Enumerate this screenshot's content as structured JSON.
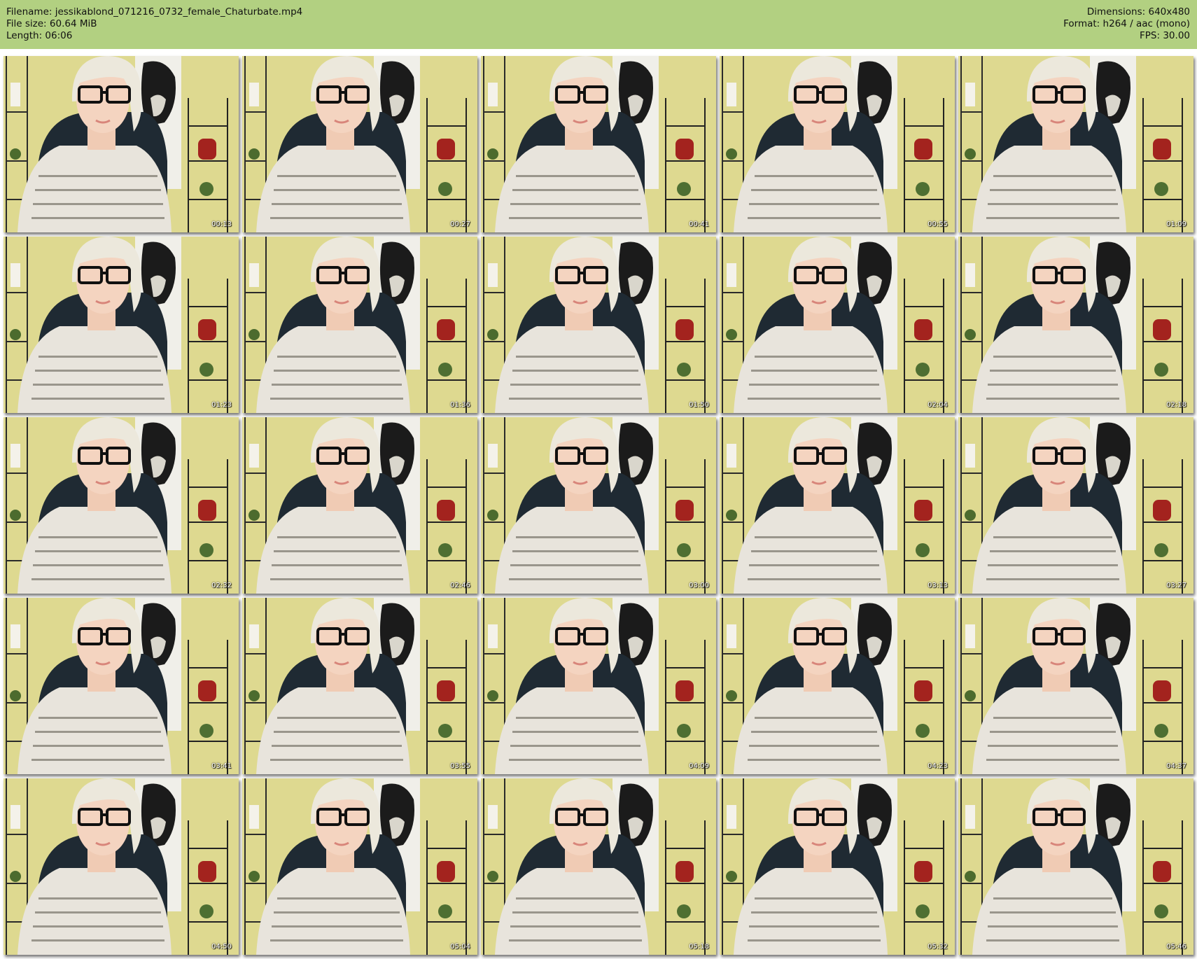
{
  "header": {
    "filename_line": "Filename: jessikablond_071216_0732_female_Chaturbate.mp4",
    "filesize_line": "File size: 60.64 MiB",
    "length_line": "Length: 06:06",
    "dimensions_line": "Dimensions: 640x480",
    "format_line": "Format: h264 / aac (mono)",
    "fps_line": "FPS: 30.00"
  },
  "colors": {
    "header_bg": "#b2d081",
    "wall": "#ded990",
    "sweater": "#e8e4dc",
    "hair": "#ece8dc",
    "chair": "#1f2a33"
  },
  "thumbnails": [
    {
      "time": "00:13"
    },
    {
      "time": "00:27"
    },
    {
      "time": "00:41"
    },
    {
      "time": "00:55"
    },
    {
      "time": "01:09"
    },
    {
      "time": "01:23"
    },
    {
      "time": "01:36"
    },
    {
      "time": "01:50"
    },
    {
      "time": "02:04"
    },
    {
      "time": "02:18"
    },
    {
      "time": "02:32"
    },
    {
      "time": "02:46"
    },
    {
      "time": "03:00"
    },
    {
      "time": "03:13"
    },
    {
      "time": "03:27"
    },
    {
      "time": "03:41"
    },
    {
      "time": "03:55"
    },
    {
      "time": "04:09"
    },
    {
      "time": "04:23"
    },
    {
      "time": "04:37"
    },
    {
      "time": "04:50"
    },
    {
      "time": "05:04"
    },
    {
      "time": "05:18"
    },
    {
      "time": "05:32"
    },
    {
      "time": "05:46"
    }
  ]
}
